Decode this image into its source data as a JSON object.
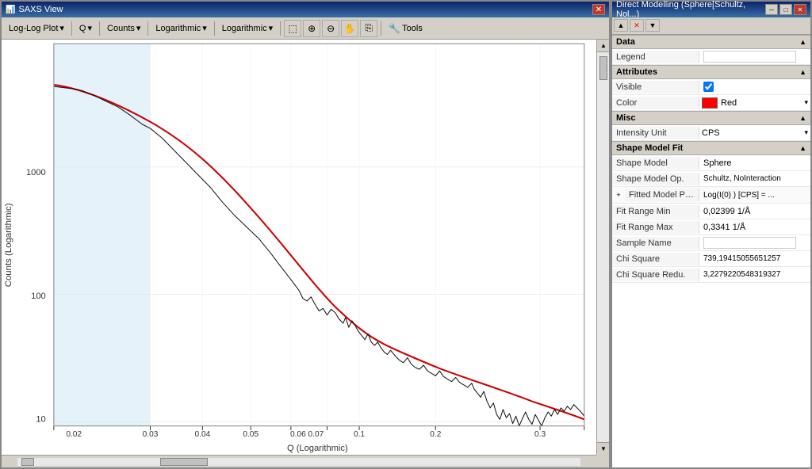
{
  "saxs_title": "SAXS View",
  "direct_modelling_title": "Direct Modelling (Sphere[Schultz, Nol...)",
  "toolbar": {
    "log_log_plot": "Log-Log Plot",
    "q_dropdown": "Q",
    "counts_dropdown": "Counts",
    "logarithmic1": "Logarithmic",
    "logarithmic2": "Logarithmic",
    "tools": "Tools"
  },
  "chart": {
    "x_label": "Q (Logarithmic)",
    "y_label": "Counts (Logarithmic)",
    "x_ticks": [
      "0.02",
      "0.03",
      "0.04",
      "0.05",
      "0.06 0.07",
      "0.1",
      "0.2",
      "0.3"
    ],
    "y_ticks": [
      "10",
      "100",
      "1000"
    ]
  },
  "properties": {
    "data_section": "Data",
    "legend_label": "Legend",
    "legend_value": "",
    "attributes_section": "Attributes",
    "visible_label": "Visible",
    "visible_checked": true,
    "color_label": "Color",
    "color_value": "Red",
    "misc_section": "Misc",
    "intensity_unit_label": "Intensity Unit",
    "intensity_unit_value": "CPS",
    "shape_model_fit_section": "Shape Model Fit",
    "shape_model_label": "Shape Model",
    "shape_model_value": "Sphere",
    "shape_model_op_label": "Shape Model Op.",
    "shape_model_op_value": "Schultz, NoInteraction",
    "fitted_model_label": "Fitted Model Par.",
    "fitted_model_value": "Log(I(0) ) [CPS] = ...",
    "fit_range_min_label": "Fit Range Min",
    "fit_range_min_value": "0,02399 1/Å",
    "fit_range_max_label": "Fit Range Max",
    "fit_range_max_value": "0,3341 1/Å",
    "sample_name_label": "Sample Name",
    "sample_name_value": "",
    "chi_square_label": "Chi Square",
    "chi_square_value": "739,19415055651257",
    "chi_square_red_label": "Chi Square Redu.",
    "chi_square_red_value": "3,2279220548319327"
  },
  "icons": {
    "close": "✕",
    "minimize": "─",
    "maximize": "□",
    "dropdown_arrow": "▾",
    "expand": "+",
    "checkbox": "✓",
    "up_arrow": "▲",
    "down_arrow": "▼",
    "left_arrow": "◄",
    "right_arrow": "►"
  }
}
